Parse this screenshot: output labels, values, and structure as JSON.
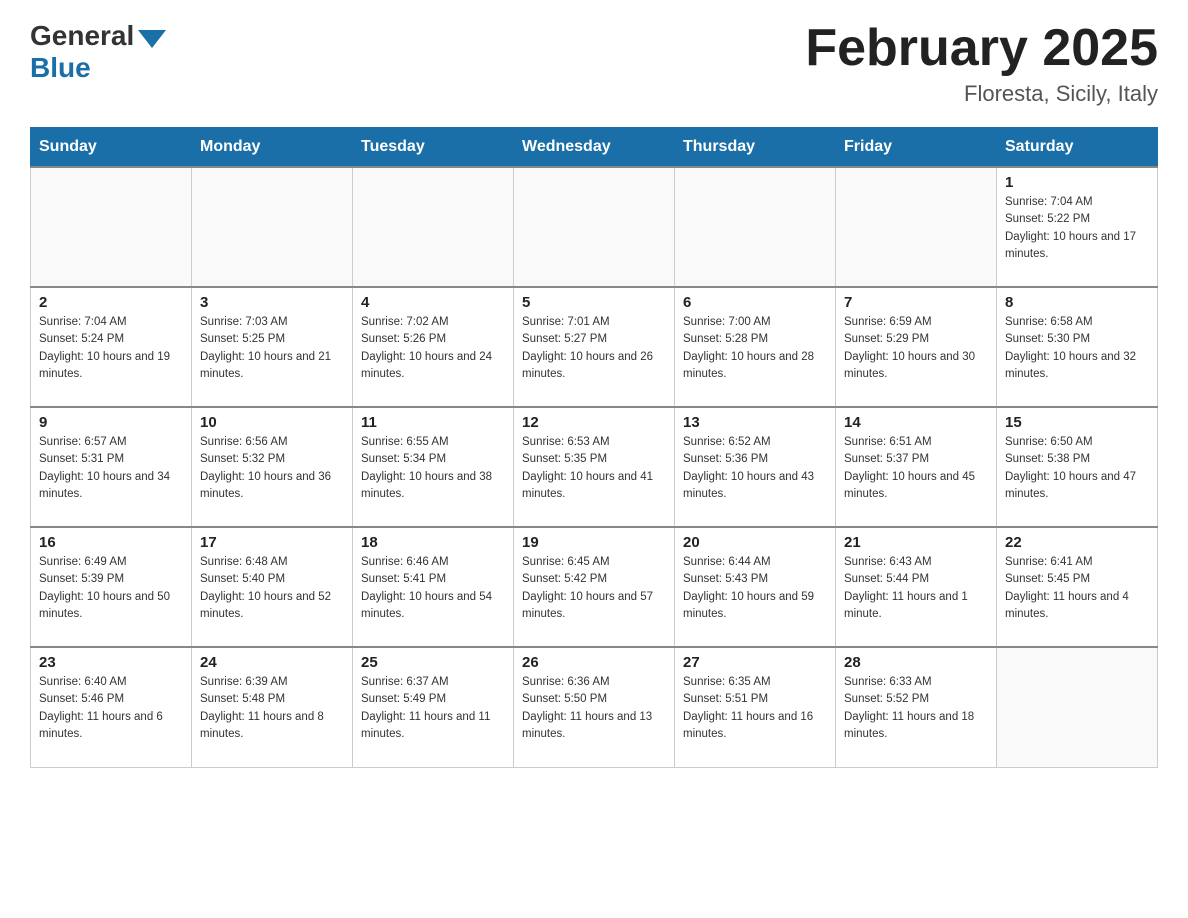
{
  "logo": {
    "general_text": "General",
    "blue_text": "Blue"
  },
  "header": {
    "title": "February 2025",
    "location": "Floresta, Sicily, Italy"
  },
  "weekdays": [
    "Sunday",
    "Monday",
    "Tuesday",
    "Wednesday",
    "Thursday",
    "Friday",
    "Saturday"
  ],
  "weeks": [
    [
      {
        "day": "",
        "info": ""
      },
      {
        "day": "",
        "info": ""
      },
      {
        "day": "",
        "info": ""
      },
      {
        "day": "",
        "info": ""
      },
      {
        "day": "",
        "info": ""
      },
      {
        "day": "",
        "info": ""
      },
      {
        "day": "1",
        "info": "Sunrise: 7:04 AM\nSunset: 5:22 PM\nDaylight: 10 hours and 17 minutes."
      }
    ],
    [
      {
        "day": "2",
        "info": "Sunrise: 7:04 AM\nSunset: 5:24 PM\nDaylight: 10 hours and 19 minutes."
      },
      {
        "day": "3",
        "info": "Sunrise: 7:03 AM\nSunset: 5:25 PM\nDaylight: 10 hours and 21 minutes."
      },
      {
        "day": "4",
        "info": "Sunrise: 7:02 AM\nSunset: 5:26 PM\nDaylight: 10 hours and 24 minutes."
      },
      {
        "day": "5",
        "info": "Sunrise: 7:01 AM\nSunset: 5:27 PM\nDaylight: 10 hours and 26 minutes."
      },
      {
        "day": "6",
        "info": "Sunrise: 7:00 AM\nSunset: 5:28 PM\nDaylight: 10 hours and 28 minutes."
      },
      {
        "day": "7",
        "info": "Sunrise: 6:59 AM\nSunset: 5:29 PM\nDaylight: 10 hours and 30 minutes."
      },
      {
        "day": "8",
        "info": "Sunrise: 6:58 AM\nSunset: 5:30 PM\nDaylight: 10 hours and 32 minutes."
      }
    ],
    [
      {
        "day": "9",
        "info": "Sunrise: 6:57 AM\nSunset: 5:31 PM\nDaylight: 10 hours and 34 minutes."
      },
      {
        "day": "10",
        "info": "Sunrise: 6:56 AM\nSunset: 5:32 PM\nDaylight: 10 hours and 36 minutes."
      },
      {
        "day": "11",
        "info": "Sunrise: 6:55 AM\nSunset: 5:34 PM\nDaylight: 10 hours and 38 minutes."
      },
      {
        "day": "12",
        "info": "Sunrise: 6:53 AM\nSunset: 5:35 PM\nDaylight: 10 hours and 41 minutes."
      },
      {
        "day": "13",
        "info": "Sunrise: 6:52 AM\nSunset: 5:36 PM\nDaylight: 10 hours and 43 minutes."
      },
      {
        "day": "14",
        "info": "Sunrise: 6:51 AM\nSunset: 5:37 PM\nDaylight: 10 hours and 45 minutes."
      },
      {
        "day": "15",
        "info": "Sunrise: 6:50 AM\nSunset: 5:38 PM\nDaylight: 10 hours and 47 minutes."
      }
    ],
    [
      {
        "day": "16",
        "info": "Sunrise: 6:49 AM\nSunset: 5:39 PM\nDaylight: 10 hours and 50 minutes."
      },
      {
        "day": "17",
        "info": "Sunrise: 6:48 AM\nSunset: 5:40 PM\nDaylight: 10 hours and 52 minutes."
      },
      {
        "day": "18",
        "info": "Sunrise: 6:46 AM\nSunset: 5:41 PM\nDaylight: 10 hours and 54 minutes."
      },
      {
        "day": "19",
        "info": "Sunrise: 6:45 AM\nSunset: 5:42 PM\nDaylight: 10 hours and 57 minutes."
      },
      {
        "day": "20",
        "info": "Sunrise: 6:44 AM\nSunset: 5:43 PM\nDaylight: 10 hours and 59 minutes."
      },
      {
        "day": "21",
        "info": "Sunrise: 6:43 AM\nSunset: 5:44 PM\nDaylight: 11 hours and 1 minute."
      },
      {
        "day": "22",
        "info": "Sunrise: 6:41 AM\nSunset: 5:45 PM\nDaylight: 11 hours and 4 minutes."
      }
    ],
    [
      {
        "day": "23",
        "info": "Sunrise: 6:40 AM\nSunset: 5:46 PM\nDaylight: 11 hours and 6 minutes."
      },
      {
        "day": "24",
        "info": "Sunrise: 6:39 AM\nSunset: 5:48 PM\nDaylight: 11 hours and 8 minutes."
      },
      {
        "day": "25",
        "info": "Sunrise: 6:37 AM\nSunset: 5:49 PM\nDaylight: 11 hours and 11 minutes."
      },
      {
        "day": "26",
        "info": "Sunrise: 6:36 AM\nSunset: 5:50 PM\nDaylight: 11 hours and 13 minutes."
      },
      {
        "day": "27",
        "info": "Sunrise: 6:35 AM\nSunset: 5:51 PM\nDaylight: 11 hours and 16 minutes."
      },
      {
        "day": "28",
        "info": "Sunrise: 6:33 AM\nSunset: 5:52 PM\nDaylight: 11 hours and 18 minutes."
      },
      {
        "day": "",
        "info": ""
      }
    ]
  ]
}
